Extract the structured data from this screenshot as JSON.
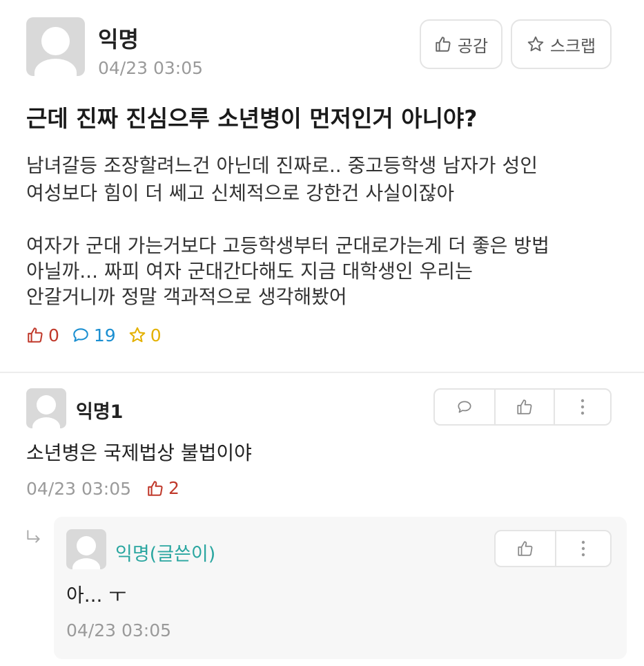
{
  "post": {
    "author": "익명",
    "timestamp": "04/23 03:05",
    "like_button_label": "공감",
    "scrap_button_label": "스크랩",
    "title": "근데 진짜 진심으루 소년병이 먼저인거 아니야?",
    "body_lines": [
      "남녀갈등 조장할려느건 아닌데 진짜로.. 중고등학생 남자가 성인",
      "여성보다 힘이 더 쎄고 신체적으로 강한건 사실이잖아",
      "여자가 군대 가는거보다 고등학생부터 군대로가는게 더 좋은 방법",
      "아닐까...  짜피 여자 군대간다해도 지금 대학생인 우리는",
      "안갈거니까 정말 객과적으로 생각해봤어"
    ],
    "stats": {
      "likes": "0",
      "comments": "19",
      "scraps": "0"
    }
  },
  "comment": {
    "author": "익명1",
    "text": "소년병은 국제법상 불법이야",
    "timestamp": "04/23 03:05",
    "likes": "2"
  },
  "reply": {
    "author": "익명(글쓴이)",
    "text": "아... ㅜ",
    "timestamp": "04/23 03:05"
  },
  "colors": {
    "like": "#c0392b",
    "comment": "#1b8fd1",
    "scrap": "#e3b100",
    "op_author": "#2aa6a0",
    "muted": "#9a9a9a"
  },
  "icons": {
    "like": "thumbs-up-icon",
    "scrap": "star-icon",
    "comment": "speech-bubble-icon",
    "more": "more-vertical-icon",
    "reply": "reply-arrow-icon"
  }
}
